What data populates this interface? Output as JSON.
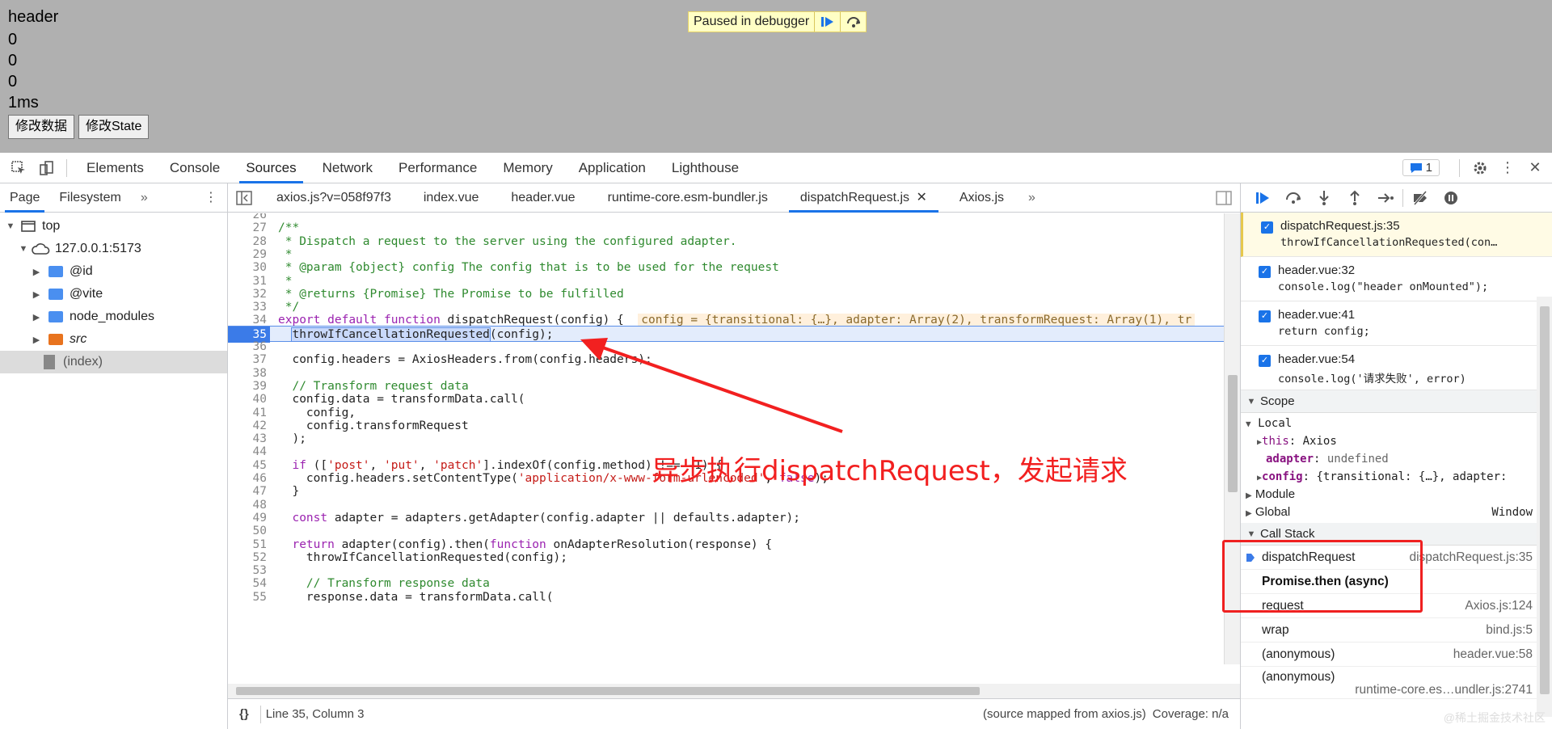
{
  "page": {
    "lines": [
      "header",
      "0",
      "0",
      "0",
      "1ms"
    ],
    "buttons": [
      "修改数据",
      "修改State"
    ],
    "paused_text": "Paused in debugger"
  },
  "devtools": {
    "tabs": [
      "Elements",
      "Console",
      "Sources",
      "Network",
      "Performance",
      "Memory",
      "Application",
      "Lighthouse"
    ],
    "active_tab": "Sources",
    "issues_count": "1"
  },
  "navigator": {
    "tabs": [
      "Page",
      "Filesystem"
    ],
    "tree": [
      {
        "label": "top",
        "indent": 0,
        "kind": "frame"
      },
      {
        "label": "127.0.0.1:5173",
        "indent": 1,
        "kind": "cloud"
      },
      {
        "label": "@id",
        "indent": 2,
        "kind": "folder"
      },
      {
        "label": "@vite",
        "indent": 2,
        "kind": "folder"
      },
      {
        "label": "node_modules",
        "indent": 2,
        "kind": "folder"
      },
      {
        "label": "src",
        "indent": 2,
        "kind": "folder-orange"
      },
      {
        "label": "(index)",
        "indent": 2,
        "kind": "file"
      }
    ]
  },
  "editor": {
    "tabs": [
      "axios.js?v=058f97f3",
      "index.vue",
      "header.vue",
      "runtime-core.esm-bundler.js",
      "dispatchRequest.js",
      "Axios.js"
    ],
    "active_tab": "dispatchRequest.js",
    "current_line": 35,
    "lines": [
      {
        "n": "26",
        "t": ""
      },
      {
        "n": "27",
        "t": "/**"
      },
      {
        "n": "28",
        "t": " * Dispatch a request to the server using the configured adapter."
      },
      {
        "n": "29",
        "t": " *"
      },
      {
        "n": "30",
        "t": " * @param {object} config The config that is to be used for the request"
      },
      {
        "n": "31",
        "t": " *"
      },
      {
        "n": "32",
        "t": " * @returns {Promise} The Promise to be fulfilled"
      },
      {
        "n": "33",
        "t": " */"
      },
      {
        "n": "34",
        "t": "export default function dispatchRequest(config) {"
      },
      {
        "n": "35",
        "t": "  throwIfCancellationRequested(config);"
      },
      {
        "n": "36",
        "t": ""
      },
      {
        "n": "37",
        "t": "  config.headers = AxiosHeaders.from(config.headers);"
      },
      {
        "n": "38",
        "t": ""
      },
      {
        "n": "39",
        "t": "  // Transform request data"
      },
      {
        "n": "40",
        "t": "  config.data = transformData.call("
      },
      {
        "n": "41",
        "t": "    config,"
      },
      {
        "n": "42",
        "t": "    config.transformRequest"
      },
      {
        "n": "43",
        "t": "  );"
      },
      {
        "n": "44",
        "t": ""
      },
      {
        "n": "45",
        "t": "  if (['post', 'put', 'patch'].indexOf(config.method) !== -1) {"
      },
      {
        "n": "46",
        "t": "    config.headers.setContentType('application/x-www-form-urlencoded', false);"
      },
      {
        "n": "47",
        "t": "  }"
      },
      {
        "n": "48",
        "t": ""
      },
      {
        "n": "49",
        "t": "  const adapter = adapters.getAdapter(config.adapter || defaults.adapter);"
      },
      {
        "n": "50",
        "t": ""
      },
      {
        "n": "51",
        "t": "  return adapter(config).then(function onAdapterResolution(response) {"
      },
      {
        "n": "52",
        "t": "    throwIfCancellationRequested(config);"
      },
      {
        "n": "53",
        "t": ""
      },
      {
        "n": "54",
        "t": "    // Transform response data"
      },
      {
        "n": "55",
        "t": "    response.data = transformData.call("
      }
    ],
    "inline_value": "config = {transitional: {…}, adapter: Array(2), transformRequest: Array(1), tr",
    "annotation": "异步执行dispatchRequest，发起请求",
    "status": {
      "position": "Line 35, Column 3",
      "source_map": "(source mapped from axios.js)",
      "coverage": "Coverage: n/a"
    }
  },
  "debugger": {
    "breakpoints": [
      {
        "file": "dispatchRequest.js:35",
        "code": "throwIfCancellationRequested(con…",
        "active": true
      },
      {
        "file": "header.vue:32",
        "code": "console.log(\"header onMounted\");",
        "active": false
      },
      {
        "file": "header.vue:41",
        "code": "return config;",
        "active": false
      },
      {
        "file": "header.vue:54",
        "code": "console.log('请求失败', error)",
        "active": false
      }
    ],
    "scope": {
      "title": "Scope",
      "local": "Local",
      "this_key": "this",
      "this_val": "Axios",
      "adapter_key": "adapter",
      "adapter_val": "undefined",
      "config_key": "config",
      "config_val": "{transitional: {…}, adapter:",
      "module": "Module",
      "global": "Global",
      "global_val": "Window"
    },
    "call_stack": {
      "title": "Call Stack",
      "frames": [
        {
          "fn": "dispatchRequest",
          "loc": "dispatchRequest.js:35",
          "current": true
        },
        {
          "fn": "Promise.then (async)",
          "loc": "",
          "async": true
        },
        {
          "fn": "request",
          "loc": "Axios.js:124"
        },
        {
          "fn": "wrap",
          "loc": "bind.js:5"
        },
        {
          "fn": "(anonymous)",
          "loc": "header.vue:58"
        },
        {
          "fn": "(anonymous)",
          "loc": "runtime-core.es…undler.js:2741"
        }
      ]
    }
  },
  "watermark": "@稀土掘金技术社区",
  "colors": {
    "accent": "#1a73e8",
    "annotation": "#f22020",
    "page_bg": "#b0b0b0"
  }
}
